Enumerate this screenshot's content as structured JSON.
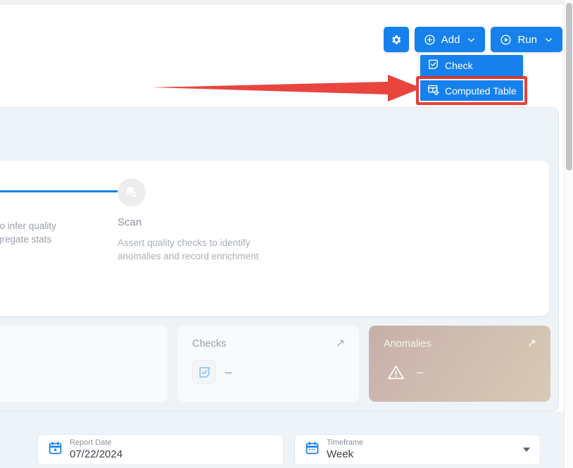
{
  "toolbar": {
    "settings_icon": "gear-icon",
    "add_label": "Add",
    "add_icon": "plus-circle-icon",
    "run_label": "Run",
    "run_icon": "play-circle-icon",
    "caret_glyph": "⌄",
    "accent_color": "#1681ed"
  },
  "dropdown": {
    "items": [
      {
        "label": "Check",
        "icon": "check-note-icon"
      },
      {
        "label": "Computed Table",
        "icon": "table-gear-icon"
      }
    ],
    "highlight_color": "#e8403a"
  },
  "annotation": {
    "arrow_color": "#e8403a",
    "points_to": "Computed Table"
  },
  "feature_card": {
    "options": [
      {
        "title": "",
        "desc_line1": "ta values to infer quality",
        "desc_line2": "collect aggregate stats"
      },
      {
        "title": "Scan",
        "icon": "database-search-icon",
        "desc_line1": "Assert quality checks to identify",
        "desc_line2": "anomalies and record enrichment"
      }
    ]
  },
  "stats": [
    {
      "title": "",
      "value": "",
      "icon": "",
      "style": "plain-empty"
    },
    {
      "title": "Checks",
      "value": "–",
      "icon": "check-note-icon",
      "style": "plain"
    },
    {
      "title": "Anomalies",
      "value": "–",
      "icon": "warning-triangle-icon",
      "style": "gradient"
    }
  ],
  "stat_arrow_glyph": "↗",
  "form": {
    "report_date": {
      "label": "Report Date",
      "value": "07/22/2024",
      "icon": "calendar-icon"
    },
    "timeframe": {
      "label": "Timeframe",
      "value": "Week",
      "icon": "calendar-week-icon",
      "options": [
        "Week"
      ]
    }
  }
}
